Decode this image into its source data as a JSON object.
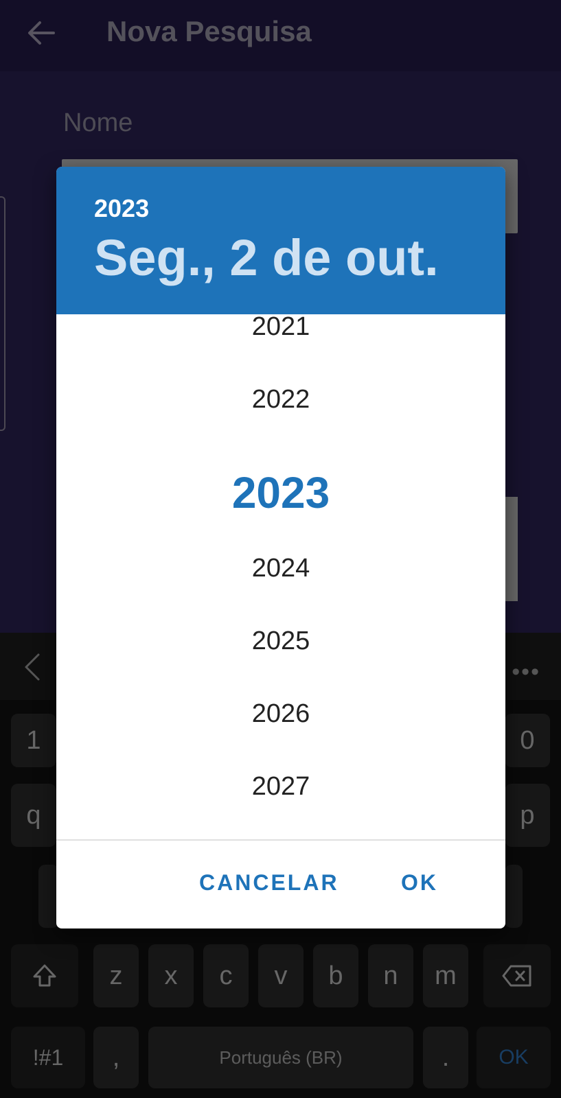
{
  "app": {
    "title": "Nova Pesquisa",
    "field_label": "Nome",
    "back_icon": "arrow-left-icon"
  },
  "dialog": {
    "header_year": "2023",
    "header_date": "Seg., 2 de out.",
    "years": [
      "2021",
      "2022",
      "2023",
      "2024",
      "2025",
      "2026",
      "2027"
    ],
    "selected_year": "2023",
    "cancel_label": "CANCELAR",
    "ok_label": "OK",
    "accent_color": "#1e73b9"
  },
  "keyboard": {
    "row_digits": [
      "1",
      "0"
    ],
    "row_top": [
      "q",
      "p"
    ],
    "row_third": [
      "z",
      "x",
      "c",
      "v",
      "b",
      "n",
      "m"
    ],
    "symbols_label": "!#1",
    "comma_label": ",",
    "space_label": "Português (BR)",
    "period_label": ".",
    "action_label": "OK"
  }
}
